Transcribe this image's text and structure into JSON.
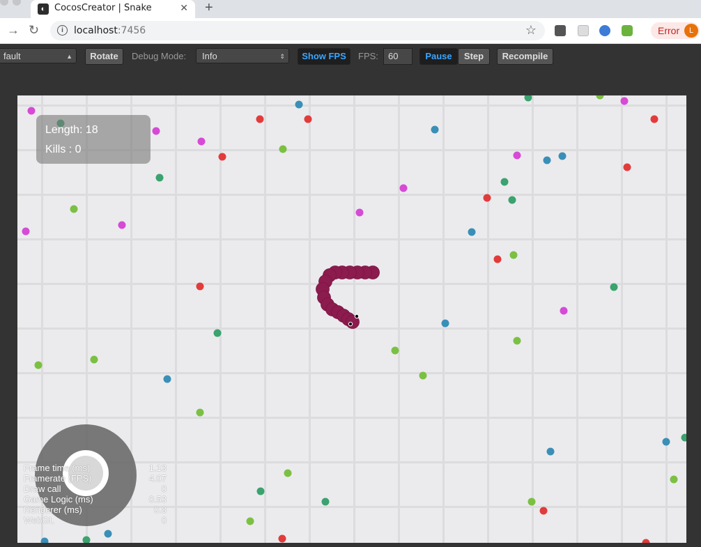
{
  "browser": {
    "tab_title": "CocosCreator | Snake",
    "tab_close": "✕",
    "new_tab": "+",
    "url_host": "localhost",
    "url_port": ":7456",
    "error_label": "Error",
    "avatar_letter": "L",
    "favicon_glyph": "◐",
    "colors": {
      "error_bg": "#fce8e6",
      "error_text": "#c5221f",
      "avatar": "#e8710a"
    }
  },
  "toolbar": {
    "device_select": "fault",
    "rotate": "Rotate",
    "debug_mode_label": "Debug Mode:",
    "debug_mode_value": "Info",
    "show_fps": "Show FPS",
    "fps_label": "FPS:",
    "fps_value": "60",
    "pause": "Pause",
    "step": "Step",
    "recompile": "Recompile",
    "colors": {
      "active_text": "#3aa6ff"
    }
  },
  "hud": {
    "length_text": "Length: 18",
    "kills_text": "Kills : 0"
  },
  "stats": [
    {
      "label": "Frame time (ms)",
      "value": "1.13"
    },
    {
      "label": "Framerate (FPS)",
      "value": "4.07"
    },
    {
      "label": "Draw call",
      "value": "0"
    },
    {
      "label": "Game Logic (ms)",
      "value": "0.53"
    },
    {
      "label": "Renderer (ms)",
      "value": "0.8"
    },
    {
      "label": "WebGL",
      "value": "0"
    }
  ],
  "game": {
    "colors": {
      "snake": "#8c1b4e",
      "red": "#e23b3b",
      "green": "#7bc043",
      "blue": "#3a8fb7",
      "magenta": "#d64ad6",
      "teal": "#3aa36e",
      "grid": "#dcdcdf",
      "background": "#ebebee"
    },
    "food": [
      [
        "magenta",
        20,
        22
      ],
      [
        "teal",
        62,
        40
      ],
      [
        "magenta",
        199,
        51
      ],
      [
        "magenta",
        264,
        66
      ],
      [
        "blue",
        404,
        13
      ],
      [
        "red",
        348,
        34
      ],
      [
        "red",
        417,
        34
      ],
      [
        "teal",
        733,
        3
      ],
      [
        "green",
        836,
        0
      ],
      [
        "magenta",
        871,
        8
      ],
      [
        "red",
        914,
        34
      ],
      [
        "blue",
        599,
        49
      ],
      [
        "green",
        381,
        77
      ],
      [
        "red",
        294,
        88
      ],
      [
        "teal",
        204,
        118
      ],
      [
        "magenta",
        717,
        86
      ],
      [
        "blue",
        760,
        93
      ],
      [
        "blue",
        782,
        87
      ],
      [
        "red",
        875,
        103
      ],
      [
        "magenta",
        554,
        133
      ],
      [
        "teal",
        699,
        124
      ],
      [
        "red",
        674,
        147
      ],
      [
        "teal",
        710,
        150
      ],
      [
        "green",
        81,
        163
      ],
      [
        "magenta",
        150,
        186
      ],
      [
        "magenta",
        12,
        195
      ],
      [
        "magenta",
        491,
        168
      ],
      [
        "blue",
        652,
        196
      ],
      [
        "red",
        689,
        235
      ],
      [
        "green",
        712,
        229
      ],
      [
        "red",
        262,
        274
      ],
      [
        "teal",
        856,
        275
      ],
      [
        "magenta",
        784,
        309
      ],
      [
        "blue",
        614,
        327
      ],
      [
        "teal",
        287,
        341
      ],
      [
        "green",
        717,
        352
      ],
      [
        "green",
        542,
        366
      ],
      [
        "green",
        30,
        387
      ],
      [
        "green",
        110,
        379
      ],
      [
        "green",
        582,
        402
      ],
      [
        "blue",
        215,
        407
      ],
      [
        "green",
        262,
        455
      ],
      [
        "blue",
        931,
        497
      ],
      [
        "teal",
        958,
        491
      ],
      [
        "blue",
        765,
        511
      ],
      [
        "green",
        942,
        551
      ],
      [
        "green",
        388,
        542
      ],
      [
        "teal",
        349,
        568
      ],
      [
        "teal",
        442,
        583
      ],
      [
        "green",
        738,
        583
      ],
      [
        "red",
        755,
        596
      ],
      [
        "green",
        334,
        611
      ],
      [
        "blue",
        130,
        629
      ],
      [
        "red",
        380,
        636
      ],
      [
        "blue",
        39,
        640
      ],
      [
        "teal",
        99,
        638
      ],
      [
        "red",
        902,
        642
      ]
    ],
    "snake": [
      [
        510,
        254
      ],
      [
        499,
        254
      ],
      [
        488,
        254
      ],
      [
        477,
        254
      ],
      [
        466,
        254
      ],
      [
        456,
        254
      ],
      [
        448,
        258
      ],
      [
        442,
        267
      ],
      [
        438,
        278
      ],
      [
        440,
        290
      ],
      [
        445,
        300
      ],
      [
        452,
        307
      ],
      [
        460,
        311
      ],
      [
        468,
        316
      ],
      [
        475,
        321
      ],
      [
        481,
        325
      ]
    ],
    "snake_head": [
      484,
      321
    ]
  }
}
